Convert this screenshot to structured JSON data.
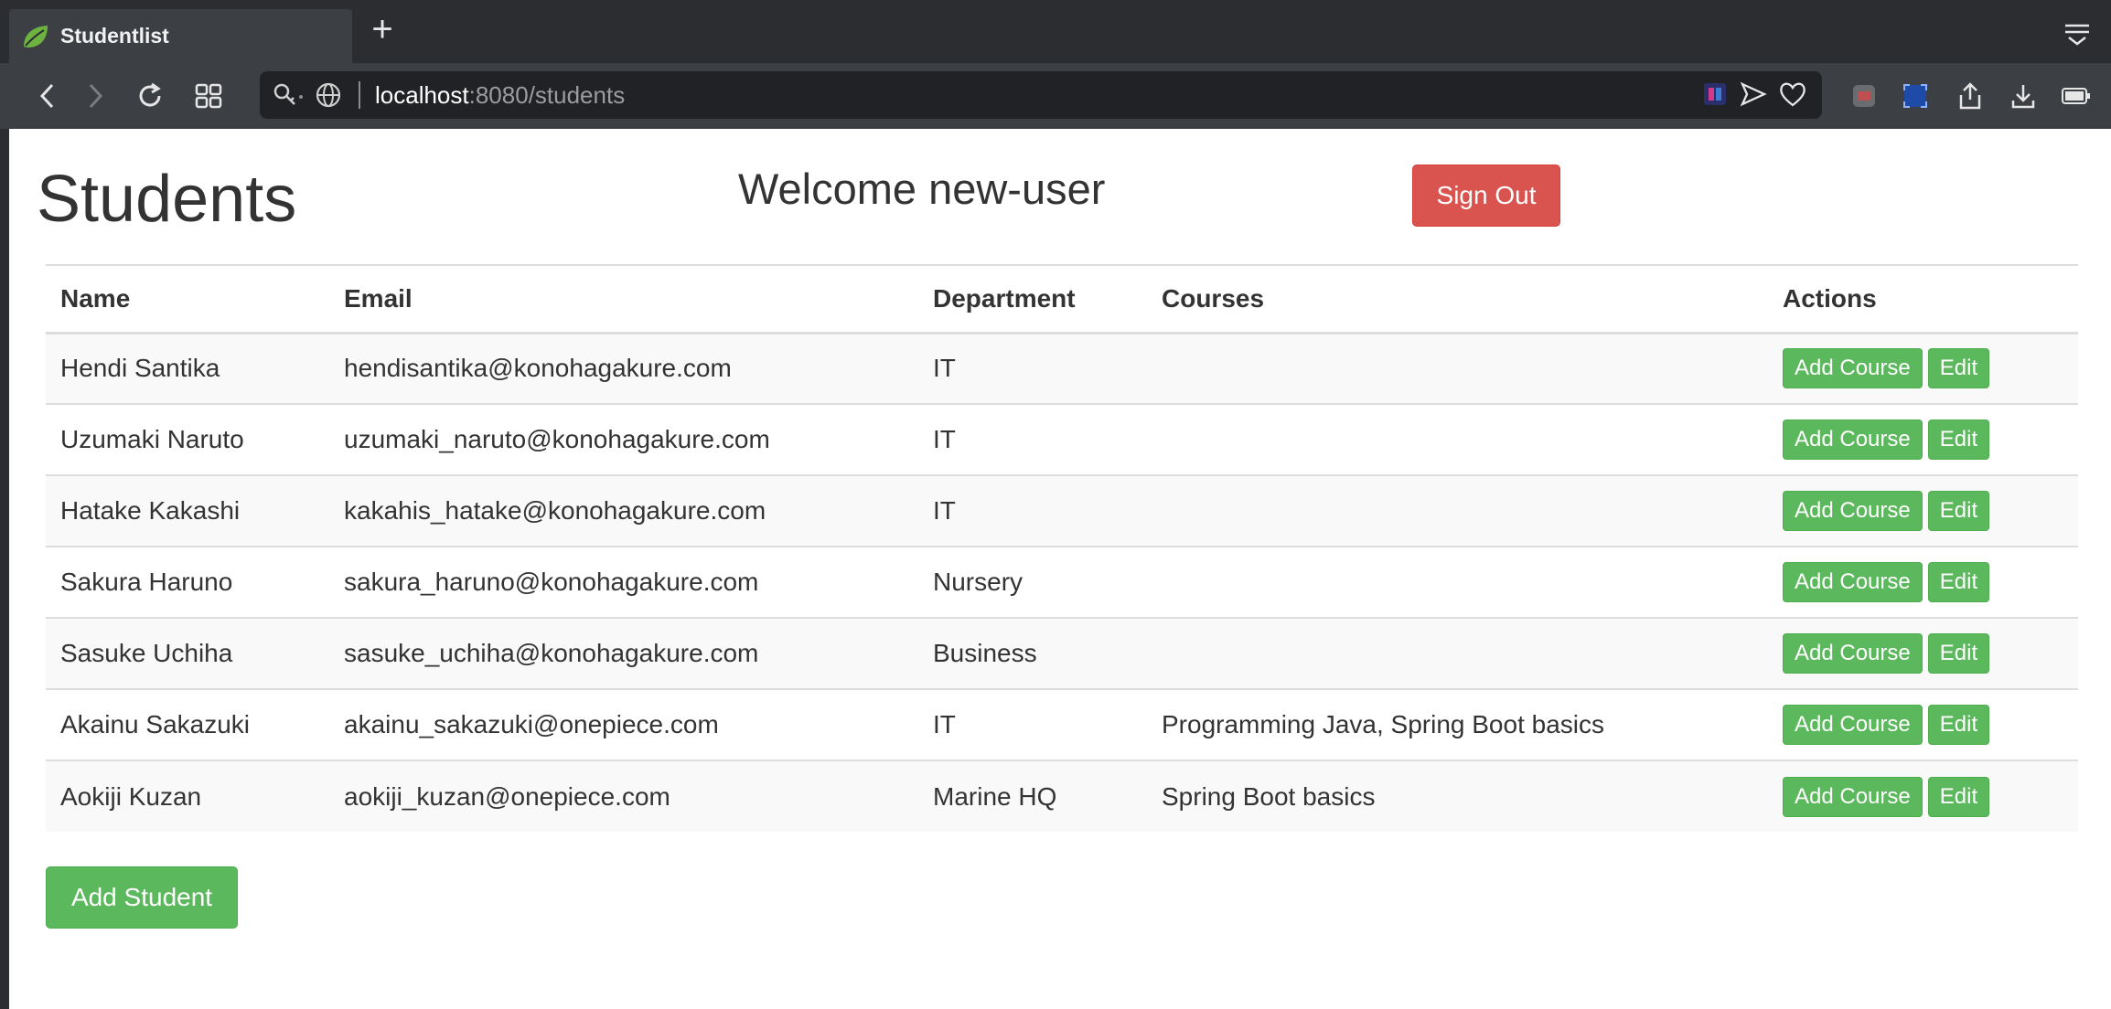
{
  "browser": {
    "tab_title": "Studentlist",
    "url_host": "localhost",
    "url_rest": ":8080/students"
  },
  "page": {
    "title": "Students",
    "welcome": "Welcome new-user",
    "signout_label": "Sign Out",
    "add_student_label": "Add Student"
  },
  "table": {
    "headers": [
      "Name",
      "Email",
      "Department",
      "Courses",
      "Actions"
    ],
    "add_course_label": "Add Course",
    "edit_label": "Edit",
    "rows": [
      {
        "name": "Hendi Santika",
        "email": "hendisantika@konohagakure.com",
        "department": "IT",
        "courses": ""
      },
      {
        "name": "Uzumaki Naruto",
        "email": "uzumaki_naruto@konohagakure.com",
        "department": "IT",
        "courses": ""
      },
      {
        "name": "Hatake Kakashi",
        "email": "kakahis_hatake@konohagakure.com",
        "department": "IT",
        "courses": ""
      },
      {
        "name": "Sakura Haruno",
        "email": "sakura_haruno@konohagakure.com",
        "department": "Nursery",
        "courses": ""
      },
      {
        "name": "Sasuke Uchiha",
        "email": "sasuke_uchiha@konohagakure.com",
        "department": "Business",
        "courses": ""
      },
      {
        "name": "Akainu Sakazuki",
        "email": "akainu_sakazuki@onepiece.com",
        "department": "IT",
        "courses": "Programming Java, Spring Boot basics"
      },
      {
        "name": "Aokiji Kuzan",
        "email": "aokiji_kuzan@onepiece.com",
        "department": "Marine HQ",
        "courses": "Spring Boot basics"
      }
    ]
  },
  "colors": {
    "danger": "#d9534f",
    "success": "#5cb85c",
    "chrome_dark": "#2b2d31"
  }
}
